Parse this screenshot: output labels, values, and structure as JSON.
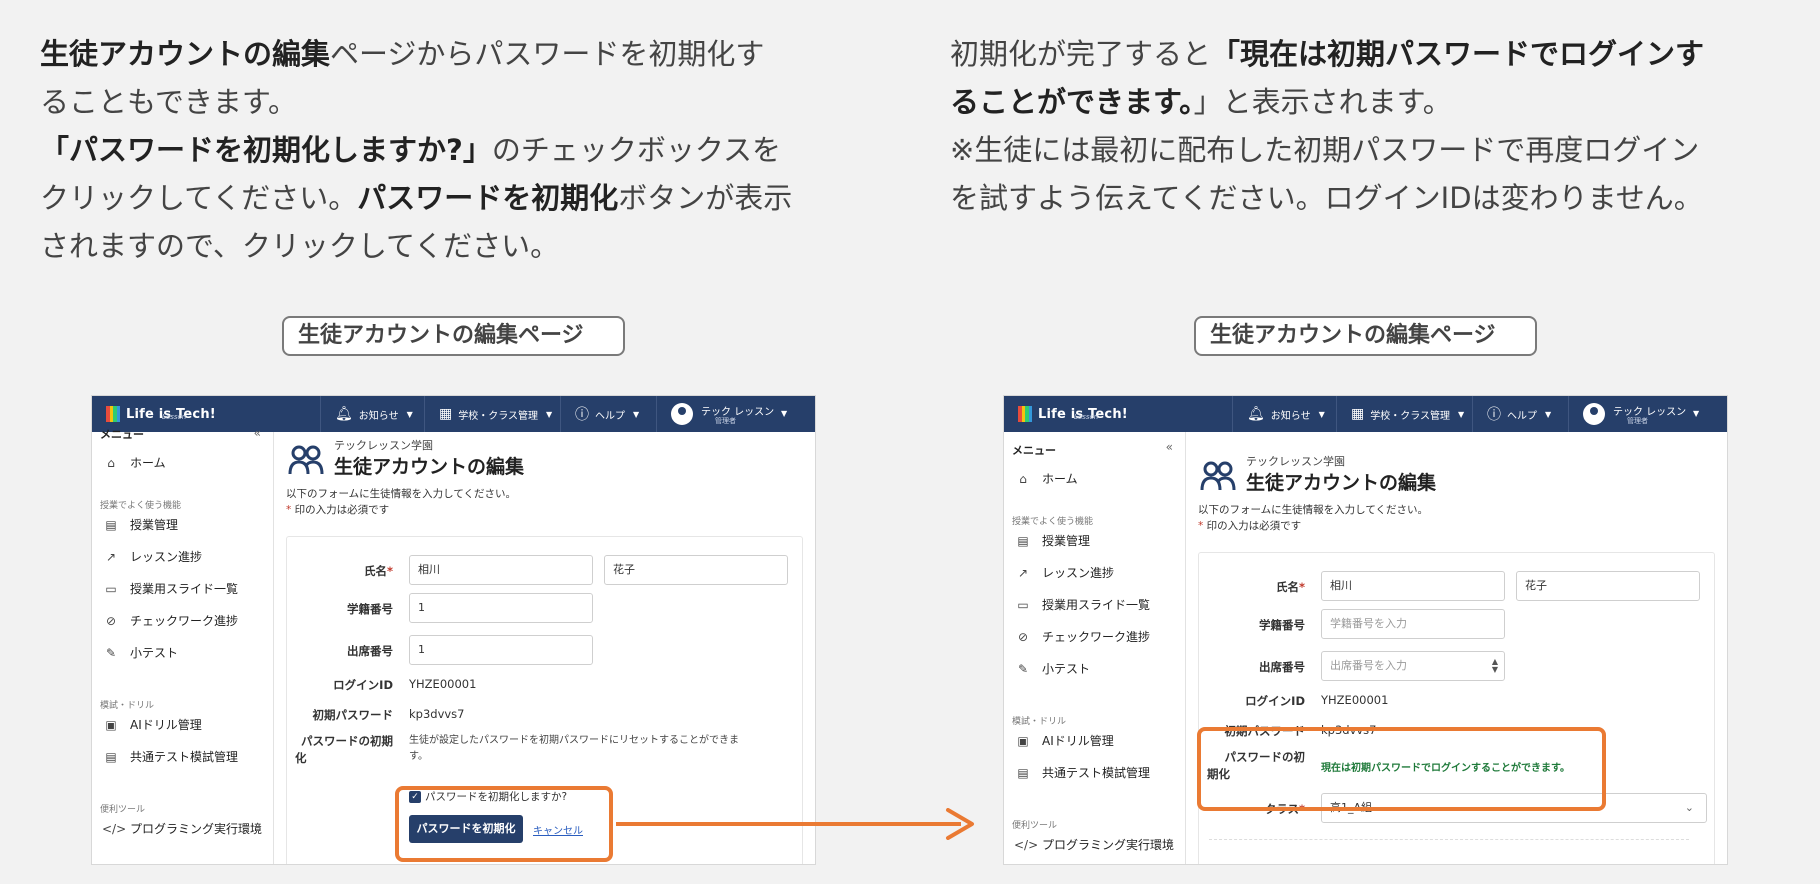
{
  "intro_left": {
    "line1_bold": "生徒アカウントの編集",
    "line1_rest": "ページからパスワードを初期化す",
    "line2": "ることもできます。",
    "line3_bold": "「パスワードを初期化しますか?」",
    "line3_rest": "のチェックボックスを",
    "line4_a": "クリックしてください。",
    "line4_bold": "パスワードを初期化",
    "line4_b": "ボタンが表示",
    "line5": "されますので、クリックしてください。"
  },
  "intro_right": {
    "line1_a": "初期化が完了すると",
    "line1_bold": "「現在は初期パスワードでログインす",
    "line2_bold": "ることができます。",
    "line2_rest": "」と表示されます。",
    "line3": "※生徒には最初に配布した初期パスワードで再度ログイン",
    "line4": "を試すよう伝えてください。ログインIDは変わりません。"
  },
  "captions": {
    "left": "生徒アカウントの編集ページ",
    "right": "生徒アカウントの編集ページ"
  },
  "app": {
    "logo_text": "Life is Tech!",
    "logo_sub": "Lesson",
    "nav": {
      "notifications": "お知らせ",
      "school_class": "学校・クラス管理",
      "help": "ヘルプ",
      "user_name": "テック レッスン",
      "user_role": "管理者"
    },
    "sidebar": {
      "menu_title": "メニュー",
      "collapse": "«",
      "home": "ホーム",
      "section_class": "授業でよく使う機能",
      "class_mgmt": "授業管理",
      "lesson_progress": "レッスン進捗",
      "slides": "授業用スライド一覧",
      "checkwork": "チェックワーク進捗",
      "quiz": "小テスト",
      "section_drill": "模試・ドリル",
      "ai_drill": "AIドリル管理",
      "mock_test": "共通テスト模試管理",
      "section_tools": "便利ツール",
      "programming": "プログラミング実行環境"
    },
    "page": {
      "school_name": "テックレッスン学園",
      "title": "生徒アカウントの編集",
      "desc1": "以下のフォームに生徒情報を入力してください。",
      "desc2_star": "*",
      "desc2": " 印の入力は必須です"
    },
    "form": {
      "name_label": "氏名",
      "required": "*",
      "last_name": "相川",
      "first_name": "花子",
      "student_no_label": "学籍番号",
      "attendance_label": "出席番号",
      "login_id_label": "ログインID",
      "login_id": "YHZE00001",
      "init_pw_label": "初期パスワード",
      "init_pw": "kp3dvvs7",
      "reset_label_1": "パスワードの初期",
      "reset_label_2": "化",
      "reset_help_1": "生徒が設定したパスワードを初期パスワードにリセットすることができま",
      "reset_help_2": "す。",
      "checkbox_label": "パスワードを初期化しますか?",
      "reset_button": "パスワードを初期化",
      "cancel": "キャンセル",
      "class_label": "クラス",
      "class_value": "高1_A組"
    },
    "left_state": {
      "student_no": "1",
      "attendance_no": "1"
    },
    "right_state": {
      "student_no_placeholder": "学籍番号を入力",
      "attendance_placeholder": "出席番号を入力",
      "reset_label_1": "パスワードの初",
      "reset_label_2": "期化",
      "success": "現在は初期パスワードでログインすることができます。"
    }
  },
  "colors": {
    "navbar": "#263f6a",
    "highlight": "#ea7a33",
    "success": "#1f7a3a"
  }
}
